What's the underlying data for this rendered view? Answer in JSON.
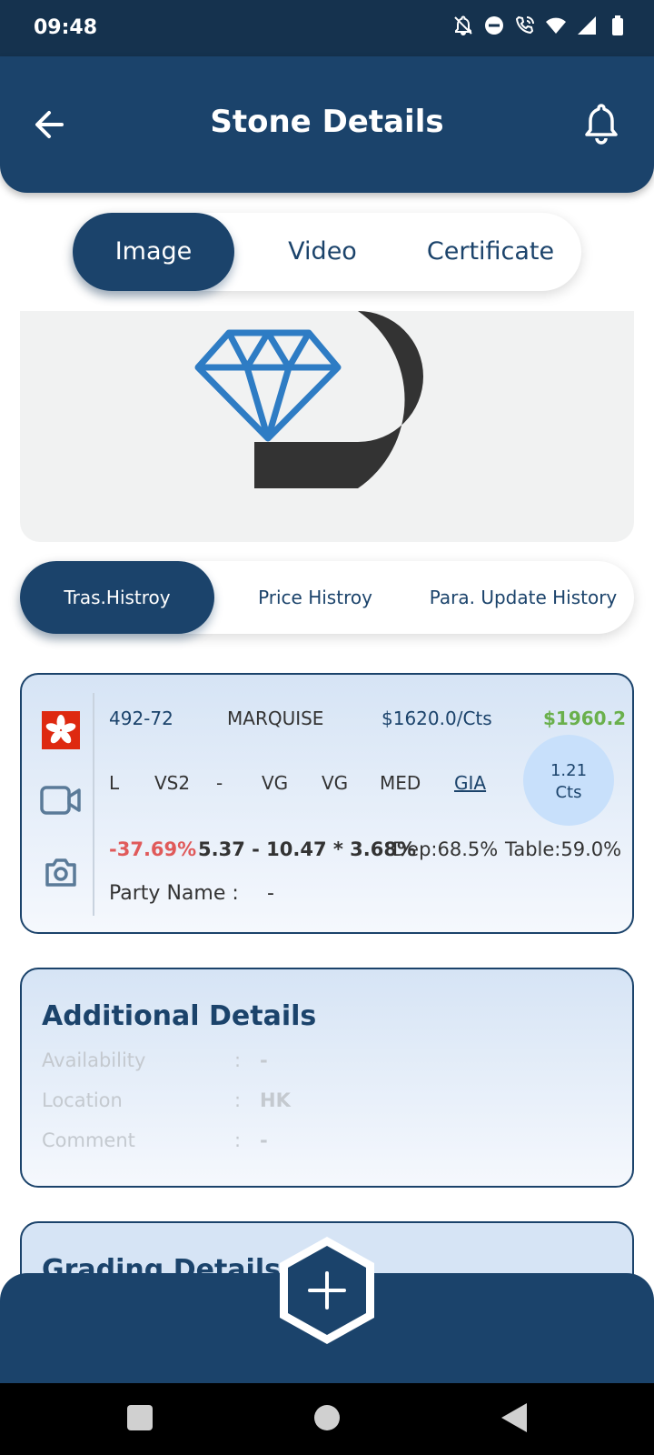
{
  "status_bar": {
    "time": "09:48"
  },
  "header": {
    "title": "Stone Details"
  },
  "media_tabs": [
    {
      "label": "Image",
      "active": true
    },
    {
      "label": "Video",
      "active": false
    },
    {
      "label": "Certificate",
      "active": false
    }
  ],
  "history_tabs": [
    {
      "label": "Tras.Histroy",
      "active": true
    },
    {
      "label": "Price Histroy",
      "active": false
    },
    {
      "label": "Para. Update History",
      "active": false
    }
  ],
  "stone": {
    "id": "492-72",
    "shape": "MARQUISE",
    "price_per_ct": "$1620.0/Cts",
    "total": "$1960.2",
    "color": "L",
    "clarity": "VS2",
    "cut": "-",
    "polish": "VG",
    "symmetry": "VG",
    "fluorescence": "MED",
    "lab": "GIA",
    "carat": "1.21",
    "carat_unit": "Cts",
    "discount": "-37.69%",
    "measurements": "5.37 - 10.47 * 3.68%",
    "depth": "Dep:68.5%",
    "table": "Table:59.0%",
    "party_label": "Party Name :",
    "party_value": "-"
  },
  "additional": {
    "title": "Additional Details",
    "rows": [
      {
        "label": "Availability",
        "value": "-"
      },
      {
        "label": "Location",
        "value": "HK"
      },
      {
        "label": "Comment",
        "value": "-"
      }
    ]
  },
  "grading": {
    "title": "Grading Details"
  },
  "colors": {
    "primary": "#1b436b",
    "positive": "#6ab04c",
    "negative": "#e05a5a"
  }
}
